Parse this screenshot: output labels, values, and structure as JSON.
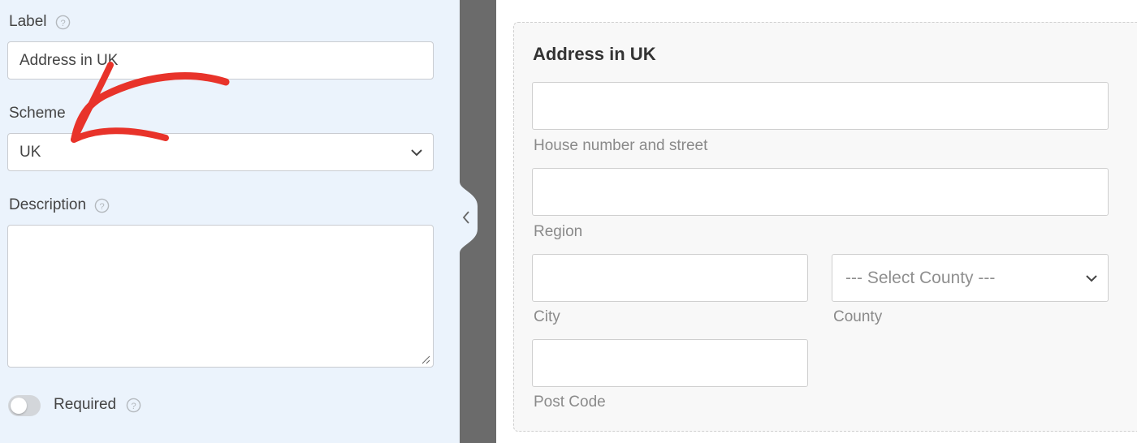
{
  "settings": {
    "label": {
      "title": "Label",
      "value": "Address in UK"
    },
    "scheme": {
      "title": "Scheme",
      "selected": "UK"
    },
    "description": {
      "title": "Description",
      "value": ""
    },
    "required": {
      "label": "Required",
      "enabled": false
    }
  },
  "preview": {
    "title": "Address in UK",
    "fields": {
      "street": "House number and street",
      "region": "Region",
      "city": "City",
      "county": "County",
      "county_placeholder": "--- Select County ---",
      "postcode": "Post Code"
    }
  },
  "colors": {
    "panel_bg": "#ebf3fc",
    "divider": "#6b6b6b",
    "annotation_arrow": "#e8332a"
  },
  "icons": {
    "help": "question-circle-icon",
    "chevron": "chevron-down-icon",
    "collapse": "chevron-left-icon"
  }
}
